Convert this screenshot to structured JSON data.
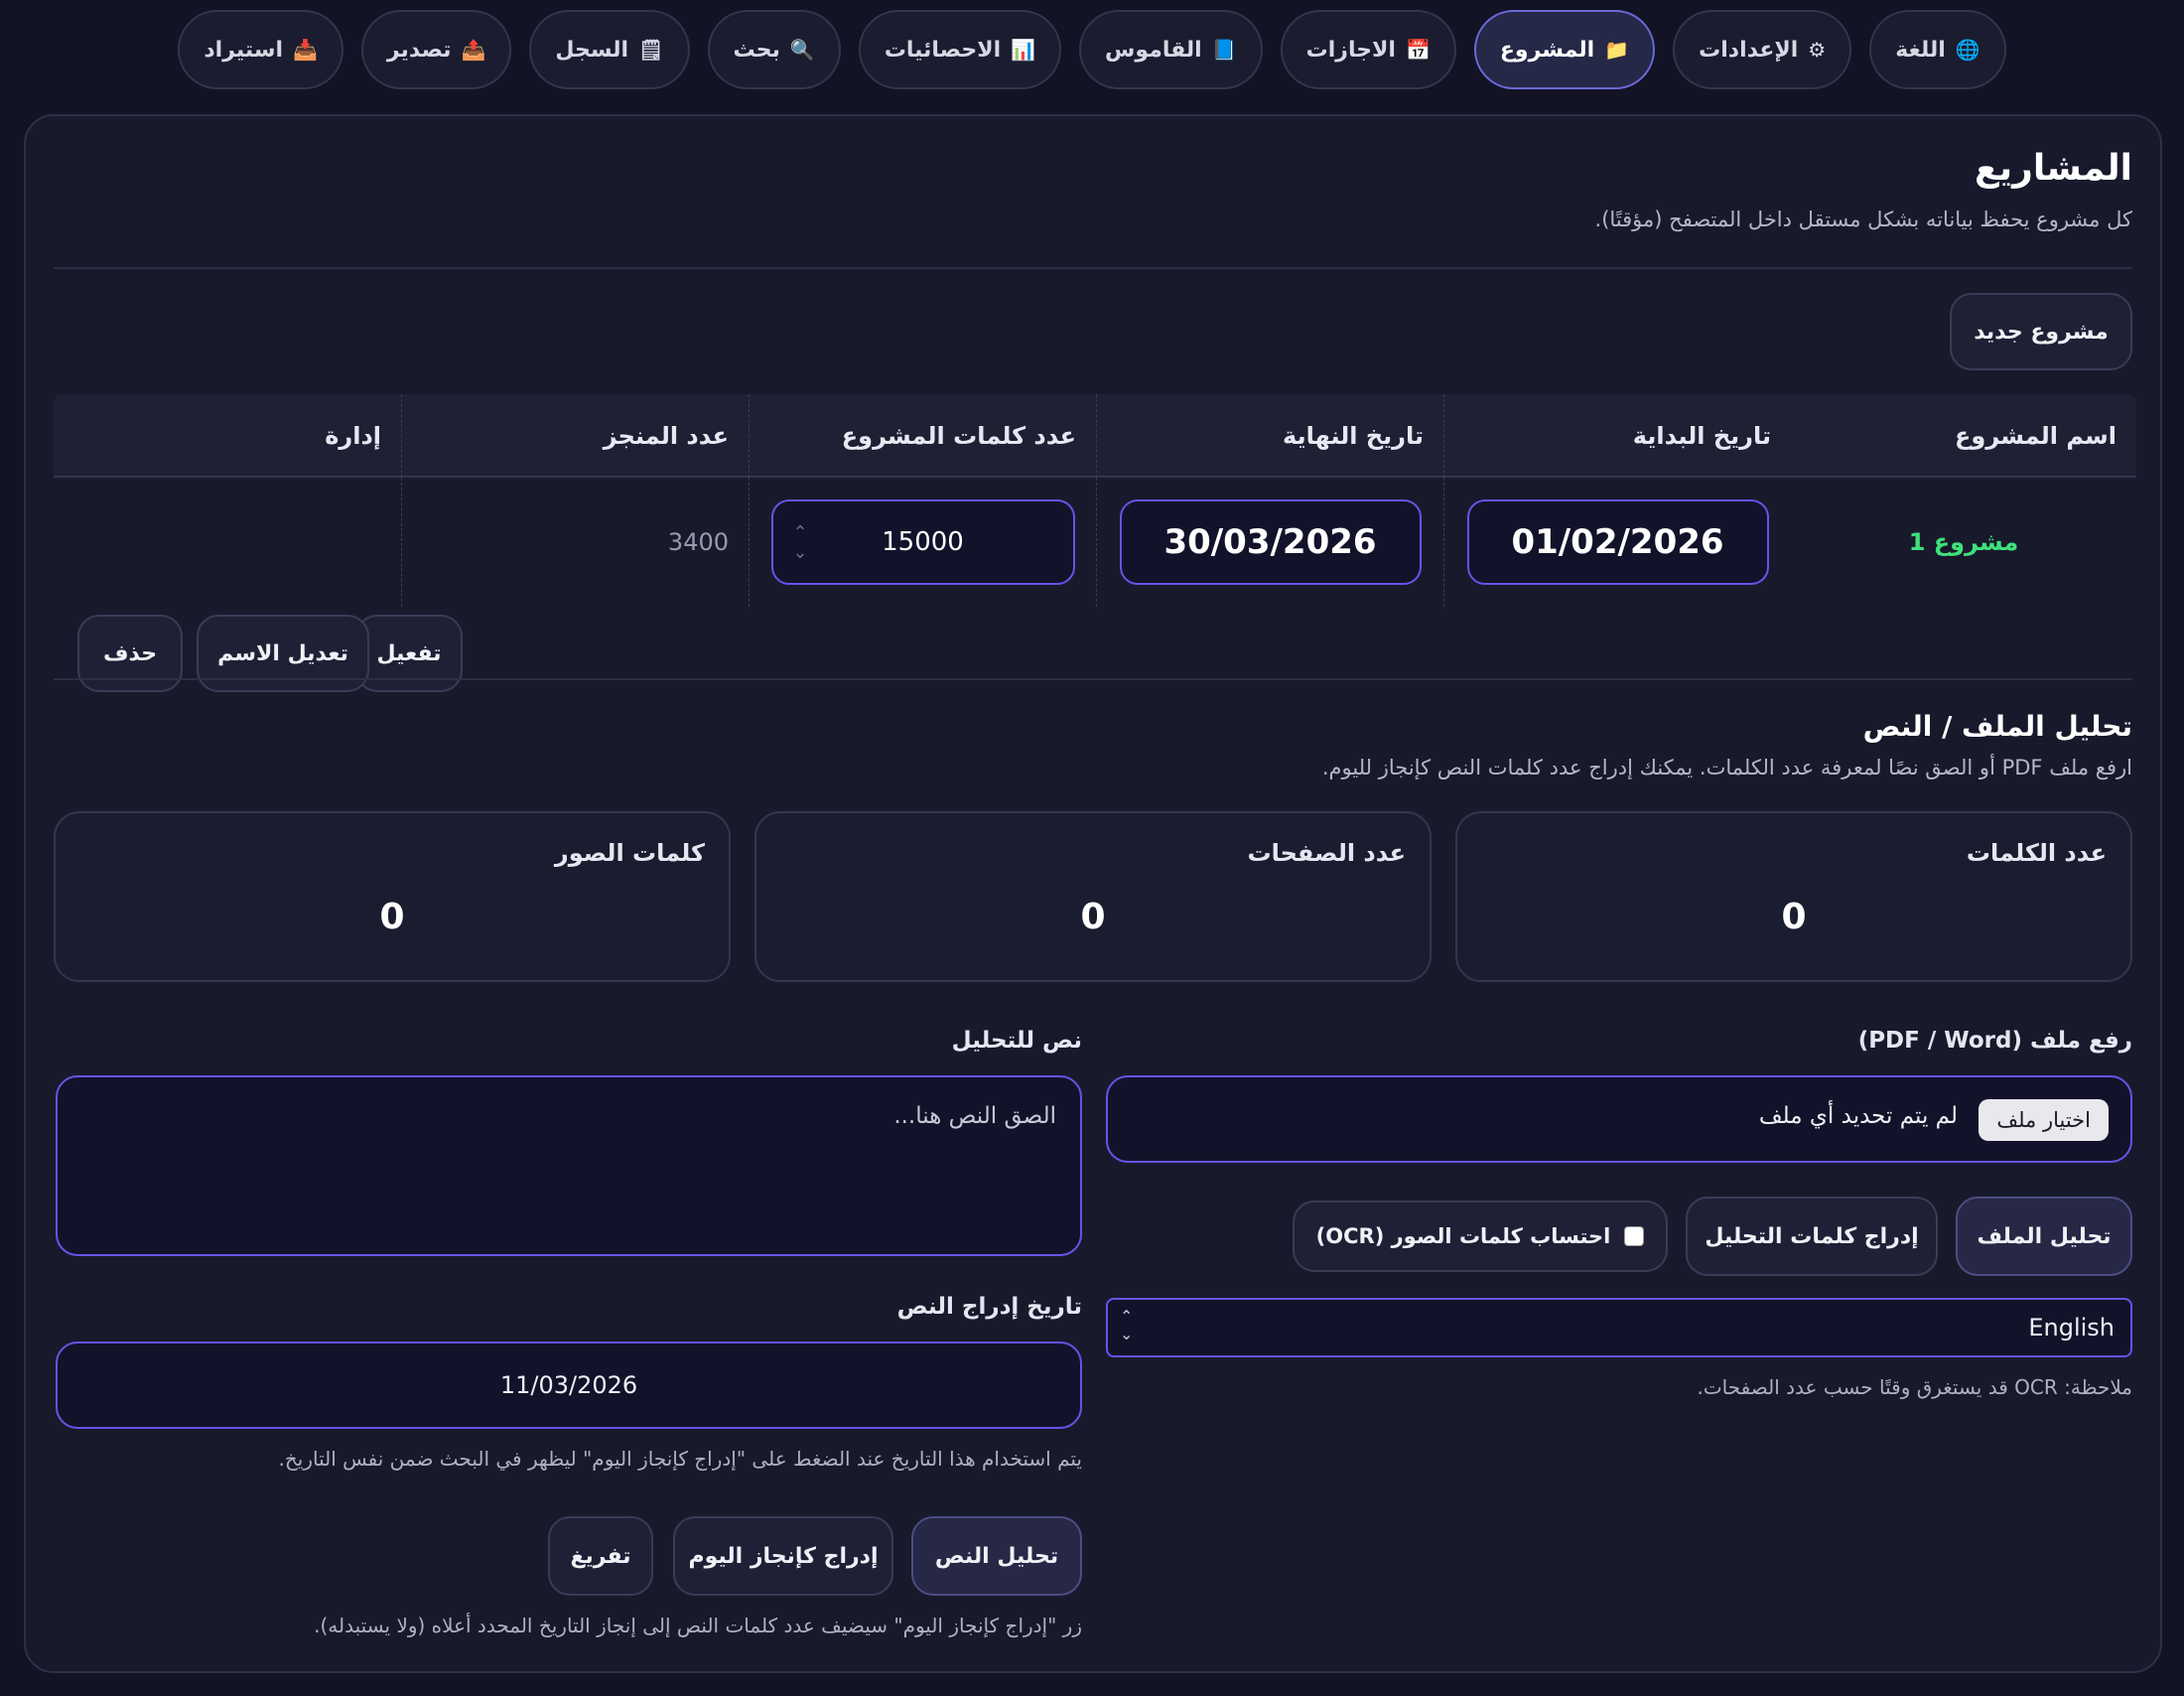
{
  "tabs": [
    {
      "label": "اللغة",
      "icon": "🌐"
    },
    {
      "label": "الإعدادات",
      "icon": "⚙"
    },
    {
      "label": "المشروع",
      "icon": "📁"
    },
    {
      "label": "الاجازات",
      "icon": "📅"
    },
    {
      "label": "القاموس",
      "icon": "📘"
    },
    {
      "label": "الاحصائيات",
      "icon": "📊"
    },
    {
      "label": "بحث",
      "icon": "🔍"
    },
    {
      "label": "السجل",
      "icon": "🗒"
    },
    {
      "label": "تصدير",
      "icon": "📤"
    },
    {
      "label": "استيراد",
      "icon": "📥"
    }
  ],
  "projects": {
    "title": "المشاريع",
    "subtitle": "كل مشروع يحفظ بياناته بشكل مستقل داخل المتصفح (مؤقتًا).",
    "new_button": "مشروع جديد",
    "columns": [
      "اسم المشروع",
      "تاريخ البداية",
      "تاريخ النهاية",
      "عدد كلمات المشروع",
      "عدد المنجز",
      "إدارة"
    ],
    "rows": [
      {
        "name": "مشروع 1",
        "start": "01/02/2026",
        "end": "30/03/2026",
        "words": "15000",
        "done": "3400",
        "actions": {
          "activate": "تفعيل",
          "rename": "تعديل الاسم",
          "delete": "حذف"
        }
      }
    ]
  },
  "analysis": {
    "title": "تحليل الملف / النص",
    "description": "ارفع ملف PDF أو الصق نصًا لمعرفة عدد الكلمات. يمكنك إدراج عدد كلمات النص كإنجاز لليوم.",
    "stats": [
      {
        "label": "عدد الكلمات",
        "value": "0"
      },
      {
        "label": "عدد الصفحات",
        "value": "0"
      },
      {
        "label": "كلمات الصور",
        "value": "0"
      }
    ],
    "file": {
      "label": "رفع ملف (PDF / Word)",
      "choose_button": "اختيار ملف",
      "status": "لم يتم تحديد أي ملف",
      "analyze_button": "تحليل الملف",
      "insert_button": "إدراج كلمات التحليل",
      "ocr_label": "احتساب كلمات الصور (OCR)",
      "language": "English",
      "note": "ملاحظة: OCR قد يستغرق وقتًا حسب عدد الصفحات."
    },
    "text": {
      "label": "نص للتحليل",
      "placeholder": "الصق النص هنا...",
      "date_label": "تاريخ إدراج النص",
      "date": "11/03/2026",
      "date_note": "يتم استخدام هذا التاريخ عند الضغط على \"إدراج كإنجاز اليوم\" ليظهر في البحث ضمن نفس التاريخ.",
      "analyze_button": "تحليل النص",
      "insert_today_button": "إدراج كإنجاز اليوم",
      "clear_button": "تفريغ",
      "footer_note": "زر \"إدراج كإنجاز اليوم\" سيضيف عدد كلمات النص إلى إنجاز التاريخ المحدد أعلاه (ولا يستبدله)."
    }
  }
}
